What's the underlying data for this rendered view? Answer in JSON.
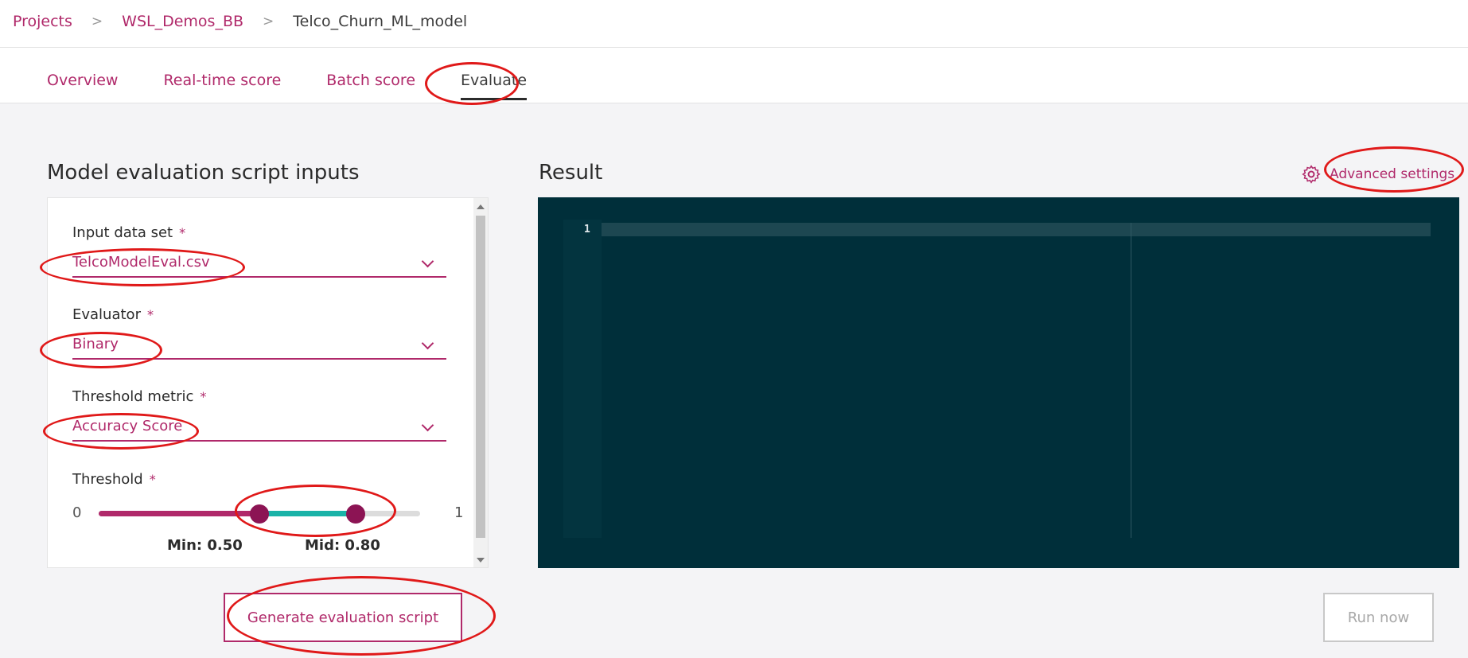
{
  "breadcrumb": {
    "items": [
      "Projects",
      "WSL_Demos_BB",
      "Telco_Churn_ML_model"
    ],
    "separator": ">"
  },
  "tabs": [
    {
      "label": "Overview",
      "active": false
    },
    {
      "label": "Real-time score",
      "active": false
    },
    {
      "label": "Batch score",
      "active": false
    },
    {
      "label": "Evaluate",
      "active": true
    }
  ],
  "left": {
    "title": "Model evaluation script inputs",
    "required_mark": "*",
    "input_data_set": {
      "label": "Input data set",
      "value": "TelcoModelEval.csv"
    },
    "evaluator": {
      "label": "Evaluator",
      "value": "Binary"
    },
    "threshold_metric": {
      "label": "Threshold metric",
      "value": "Accuracy Score"
    },
    "threshold": {
      "label": "Threshold",
      "min_label": "0",
      "max_label": "1",
      "min_value": 0.5,
      "mid_value": 0.8,
      "min_text": "Min: 0.50",
      "mid_text": "Mid: 0.80"
    },
    "generate_button": "Generate evaluation script"
  },
  "right": {
    "title": "Result",
    "advanced_settings": "Advanced settings",
    "editor": {
      "line_number": "1"
    },
    "run_button": "Run now"
  },
  "colors": {
    "accent": "#b0296a",
    "teal": "#1ab3a8",
    "editor_bg": "#002f3a",
    "annotation": "#e01919"
  },
  "icons": [
    "chevron-down-icon",
    "gear-icon"
  ]
}
